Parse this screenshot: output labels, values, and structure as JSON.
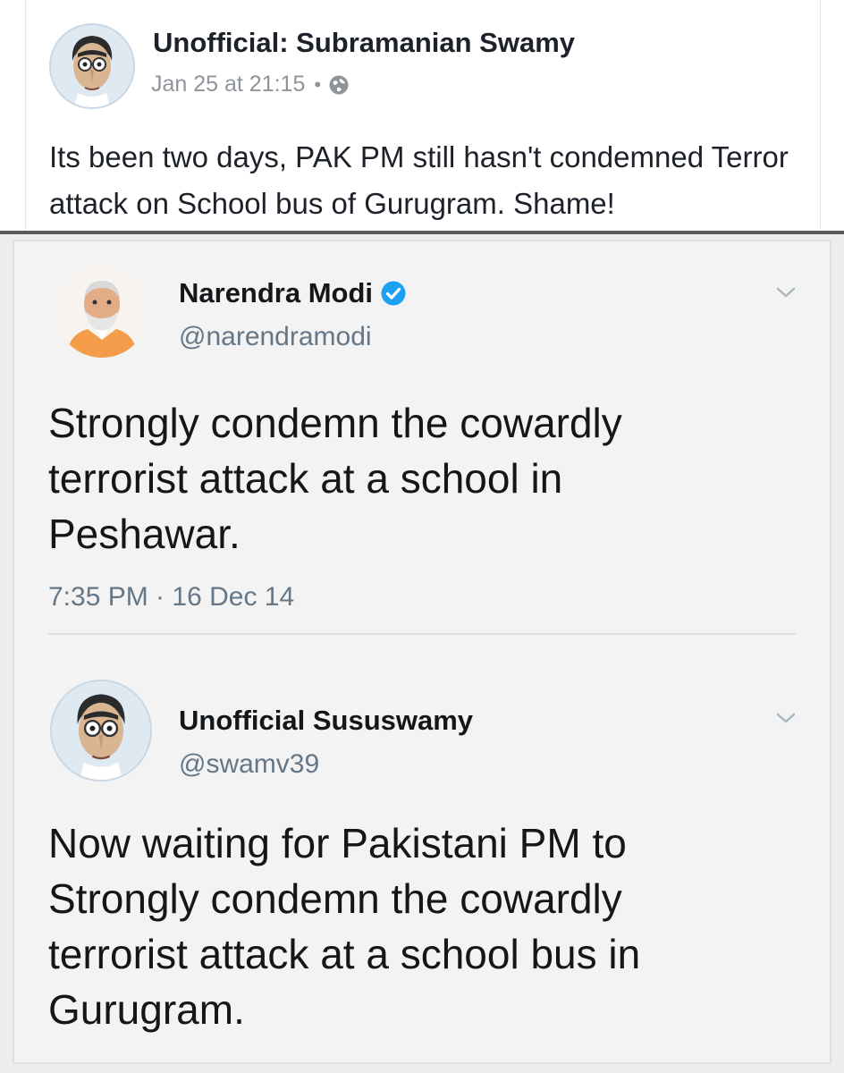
{
  "facebook_post": {
    "author": "Unofficial: Subramanian Swamy",
    "date": "Jan 25 at 21:15",
    "separator": "•",
    "audience_icon": "globe-icon",
    "text": "Its been two days, PAK PM still hasn't condemned Terror attack on School bus of Gurugram. Shame!"
  },
  "tweets": [
    {
      "name": "Narendra Modi",
      "verified": true,
      "handle": "@narendramodi",
      "text": "Strongly condemn the cowardly terrorist attack at a school in Peshawar.",
      "timestamp": "7:35 PM · 16 Dec 14",
      "menu_icon": "chevron-down-icon"
    },
    {
      "name": "Unofficial Sususwamy",
      "verified": false,
      "handle": "@swamv39",
      "text": "Now waiting for Pakistani PM to Strongly condemn the cowardly terrorist attack at a school bus in Gurugram.",
      "menu_icon": "chevron-down-icon"
    }
  ],
  "colors": {
    "verified_blue": "#1da1f2",
    "muted_text": "#657786",
    "fb_muted": "#8f949b"
  }
}
